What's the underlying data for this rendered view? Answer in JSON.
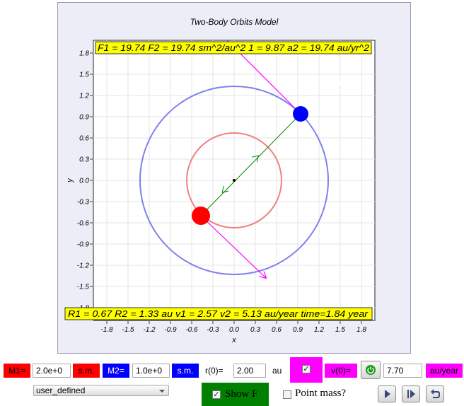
{
  "plot": {
    "title": "Two-Body Orbits Model",
    "xlabel": "x",
    "ylabel": "y",
    "top_readout": "F1 = 19.74 F2 = 19.74 sm^2/au^2 1 = 9.87 a2 = 19.74 au/yr^2",
    "bottom_readout": "R1 = 0.67 R2 = 1.33 au v1 = 2.57 v2 = 5.13 au/year time=1.84 year",
    "xticks": [
      "-1.8",
      "-1.5",
      "-1.2",
      "-0.9",
      "-0.6",
      "-0.3",
      "0.0",
      "0.3",
      "0.6",
      "0.9",
      "1.2",
      "1.5",
      "1.8"
    ],
    "yticks": [
      "1.8",
      "1.5",
      "1.2",
      "0.9",
      "0.6",
      "0.3",
      "0.0",
      "-0.3",
      "-0.6",
      "-0.9",
      "-1.2",
      "-1.5",
      "-1.8"
    ],
    "orbit1": {
      "center": [
        0,
        0
      ],
      "radius": 0.67,
      "color": "#f08080"
    },
    "orbit2": {
      "center": [
        0,
        0
      ],
      "radius": 1.33,
      "color": "#8080f0"
    },
    "body1": {
      "x": -0.47,
      "y": -0.5,
      "color": "#ff0000"
    },
    "body2": {
      "x": 0.94,
      "y": 0.94,
      "color": "#0000ff"
    },
    "body1_force_tip": {
      "x": 0.45,
      "y": -1.38
    },
    "body2_force_start": {
      "x": -0.1,
      "y": 1.98
    },
    "colors": {
      "force": "#ff00ff",
      "link": "#008000"
    }
  },
  "controls": {
    "m1_label": "M1=",
    "m1_value": "2.0e+0",
    "m1_unit": "s.m.",
    "m2_label": "M2=",
    "m2_value": "1.0e+0",
    "m2_unit": "s.m.",
    "r0_label": "r(0)=",
    "r0_value": "2.00",
    "r0_unit": "au",
    "v0_check": "✓",
    "v0_label": "v(0)=",
    "v0_value": "7.70",
    "v0_unit": "au/year",
    "preset_value": "user_defined",
    "show_f_label": "Show F",
    "show_f_check": "✓",
    "point_mass_label": "Point mass?",
    "colors": {
      "red": "#ff0000",
      "blue": "#0000ff",
      "magenta": "#ff00ff",
      "green": "#008000"
    }
  }
}
